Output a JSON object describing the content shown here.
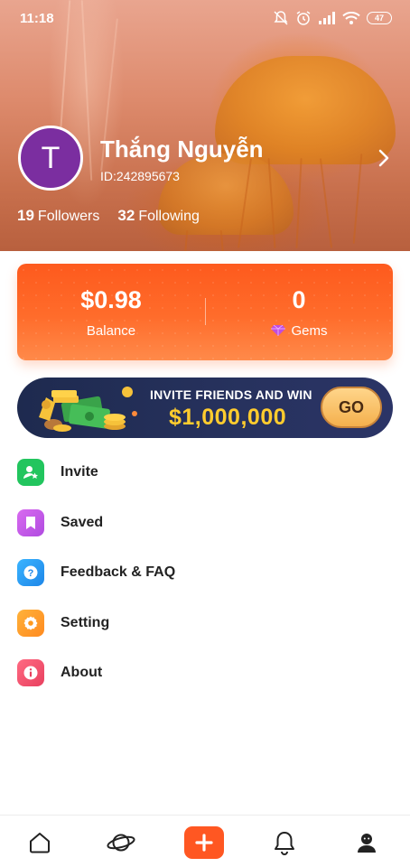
{
  "status_bar": {
    "time": "11:18",
    "battery": "47"
  },
  "profile": {
    "avatar_initial": "T",
    "name": "Thắng Nguyễn",
    "id_text": "ID:242895673",
    "followers_count": "19",
    "followers_label": "Followers",
    "following_count": "32",
    "following_label": "Following"
  },
  "wallet": {
    "balance_value": "$0.98",
    "balance_label": "Balance",
    "gems_value": "0",
    "gems_label": "Gems"
  },
  "banner": {
    "line1": "INVITE FRIENDS AND WIN",
    "line2": "$1,000,000",
    "button": "GO"
  },
  "menu": [
    {
      "label": "Invite",
      "icon": "invite-icon",
      "color": "#22c55e"
    },
    {
      "label": "Saved",
      "icon": "bookmark-icon",
      "color": "#c04de0"
    },
    {
      "label": "Feedback & FAQ",
      "icon": "help-icon",
      "color": "#1e9bf0"
    },
    {
      "label": "Setting",
      "icon": "gear-icon",
      "color": "#ff9a1f"
    },
    {
      "label": "About",
      "icon": "info-icon",
      "color": "#f04a6a"
    }
  ],
  "bottom_nav": [
    {
      "icon": "home-icon"
    },
    {
      "icon": "planet-icon"
    },
    {
      "icon": "plus-icon"
    },
    {
      "icon": "bell-icon"
    },
    {
      "icon": "profile-icon"
    }
  ],
  "colors": {
    "accent": "#ff5722",
    "wallet_start": "#fe5a1d",
    "avatar": "#7b2ea0",
    "banner_bg": "#1e2a4f",
    "banner_gold": "#ffcc2e"
  }
}
